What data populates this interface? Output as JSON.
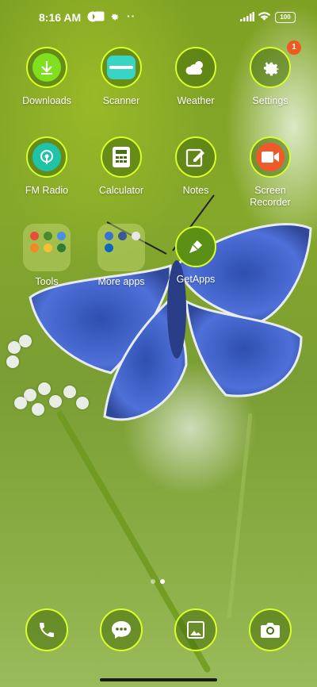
{
  "status_bar": {
    "time": "8:16 AM",
    "battery": "100",
    "icons": [
      "notification-app-icon",
      "square-icon",
      "gear-icon",
      "more-dots-icon",
      "signal-icon",
      "wifi-icon",
      "battery-icon"
    ]
  },
  "apps": {
    "downloads": "Downloads",
    "scanner": "Scanner",
    "weather": "Weather",
    "settings": "Settings",
    "settings_badge": "1",
    "fm_radio": "FM Radio",
    "calculator": "Calculator",
    "notes": "Notes",
    "screen_recorder": "Screen\nRecorder",
    "tools": "Tools",
    "more_apps": "More apps",
    "getapps": "GetApps"
  },
  "dock": {
    "icons": [
      "phone-icon",
      "messages-icon",
      "gallery-icon",
      "camera-icon"
    ]
  },
  "pager": {
    "pages": 2,
    "current": 2
  },
  "colors": {
    "ring": "#d7ff2a",
    "badge": "#ef5a21",
    "wallpaper_green": "#7fa123"
  }
}
